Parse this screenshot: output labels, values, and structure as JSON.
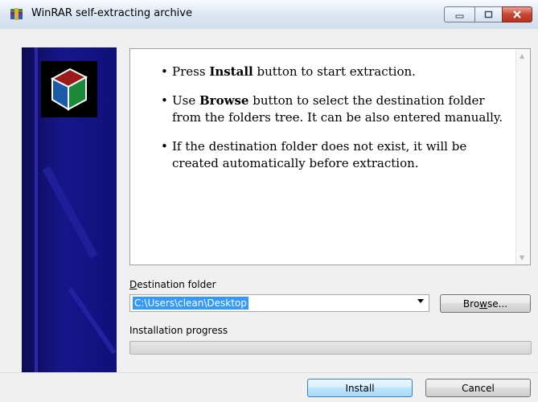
{
  "window": {
    "title": "WinRAR self-extracting archive"
  },
  "instructions": [
    {
      "before": "Press ",
      "bold": "Install",
      "after": " button to start extraction."
    },
    {
      "before": "Use ",
      "bold": "Browse",
      "after": " button to select the destination folder from the folders tree. It can be also entered manually."
    },
    {
      "before": "",
      "bold": "",
      "after": "If the destination folder does not exist, it will be created automatically before extraction."
    }
  ],
  "destination": {
    "label_pre": "",
    "label_mnemonic": "D",
    "label_post": "estination folder",
    "value": "C:\\Users\\clean\\Desktop"
  },
  "browse": {
    "label_pre": "Bro",
    "label_mnemonic": "w",
    "label_post": "se..."
  },
  "progress": {
    "label": "Installation progress",
    "value": 0
  },
  "buttons": {
    "install": "Install",
    "cancel": "Cancel"
  },
  "colors": {
    "side_panel": "#16168c",
    "selection": "#3399ff",
    "close_button": "#c94532"
  },
  "icons": {
    "app": "winrar-icon",
    "logo": "book-box-icon",
    "minimize": "minimize-icon",
    "maximize": "maximize-icon",
    "close": "close-icon",
    "dropdown": "chevron-down-icon"
  }
}
